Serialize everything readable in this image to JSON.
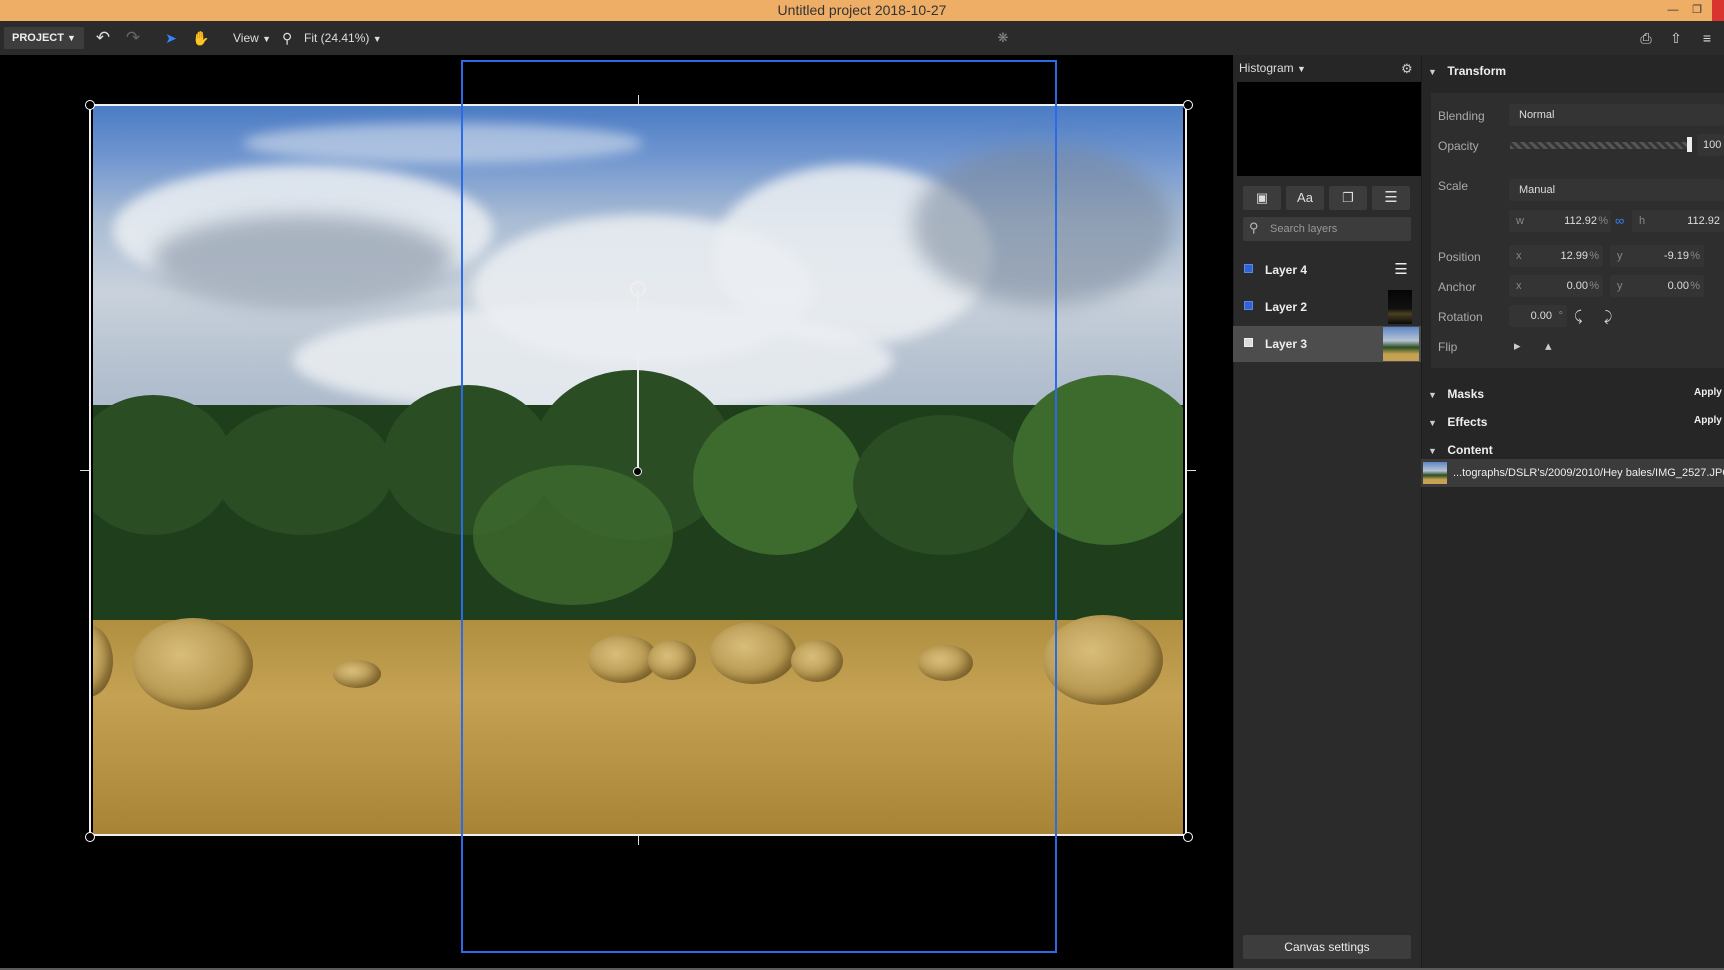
{
  "window": {
    "title": "Untitled project 2018-10-27"
  },
  "toolbar": {
    "project_label": "PROJECT",
    "view_label": "View",
    "zoom_label": "Fit (24.41%)"
  },
  "histogram_panel": {
    "title": "Histogram",
    "tool_text_label": "Aa",
    "search_placeholder": "Search layers",
    "layers": [
      {
        "name": "Layer 4",
        "selected": false
      },
      {
        "name": "Layer 2",
        "selected": false
      },
      {
        "name": "Layer 3",
        "selected": true
      }
    ],
    "canvas_settings_label": "Canvas settings"
  },
  "transform_panel": {
    "title": "Transform",
    "blending_label": "Blending",
    "blending_value": "Normal",
    "opacity_label": "Opacity",
    "opacity_value": "100",
    "scale_label": "Scale",
    "scale_value": "Manual",
    "scale_w_label": "w",
    "scale_w_value": "112.92",
    "scale_h_label": "h",
    "scale_h_value": "112.92",
    "position_label": "Position",
    "position_x": "12.99",
    "position_y": "-9.19",
    "anchor_label": "Anchor",
    "anchor_x": "0.00",
    "anchor_y": "0.00",
    "rotation_label": "Rotation",
    "rotation_value": "0.00",
    "rotation_unit": "°",
    "flip_label": "Flip",
    "x_label": "x",
    "y_label": "y",
    "percent": "%"
  },
  "masks": {
    "title": "Masks",
    "apply_label": "Apply"
  },
  "effects": {
    "title": "Effects",
    "apply_label": "Apply"
  },
  "content": {
    "title": "Content",
    "file_path": "...tographs/DSLR's/2009/2010/Hey bales/IMG_2527.JPG"
  },
  "colors": {
    "title_bar": "#eeae66",
    "selection_accent": "#2c6be8",
    "panel_bg": "#2b2b2b"
  }
}
